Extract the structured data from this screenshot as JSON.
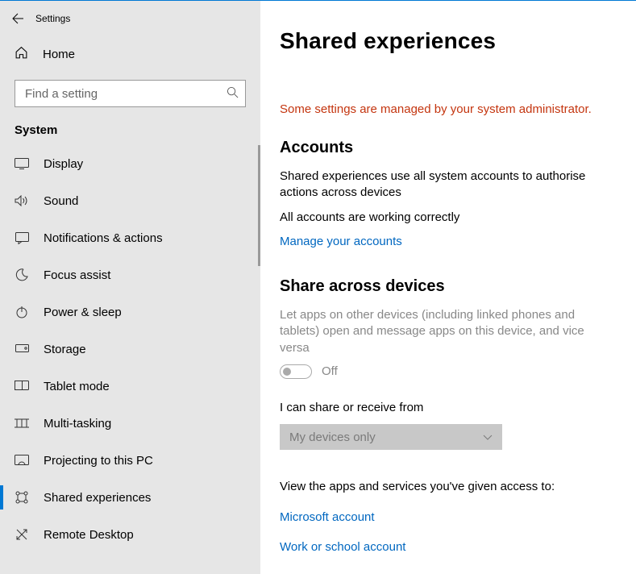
{
  "window": {
    "title": "Settings"
  },
  "sidebar": {
    "home_label": "Home",
    "search_placeholder": "Find a setting",
    "section_heading": "System",
    "items": [
      {
        "label": "Display"
      },
      {
        "label": "Sound"
      },
      {
        "label": "Notifications & actions"
      },
      {
        "label": "Focus assist"
      },
      {
        "label": "Power & sleep"
      },
      {
        "label": "Storage"
      },
      {
        "label": "Tablet mode"
      },
      {
        "label": "Multi-tasking"
      },
      {
        "label": "Projecting to this PC"
      },
      {
        "label": "Shared experiences"
      },
      {
        "label": "Remote Desktop"
      }
    ]
  },
  "main": {
    "title": "Shared experiences",
    "admin_message": "Some settings are managed by your system administrator.",
    "accounts": {
      "heading": "Accounts",
      "description": "Shared experiences use all system accounts to authorise actions across devices",
      "status": "All accounts are working correctly",
      "manage_link": "Manage your accounts"
    },
    "share": {
      "heading": "Share across devices",
      "description": "Let apps on other devices (including linked phones and tablets) open and message apps on this device, and vice versa",
      "toggle_state": "Off",
      "receive_label": "I can share or receive from",
      "dropdown_value": "My devices only",
      "apps_access_label": "View the apps and services you've given access to:",
      "msa_link": "Microsoft account",
      "work_link": "Work or school account"
    }
  }
}
